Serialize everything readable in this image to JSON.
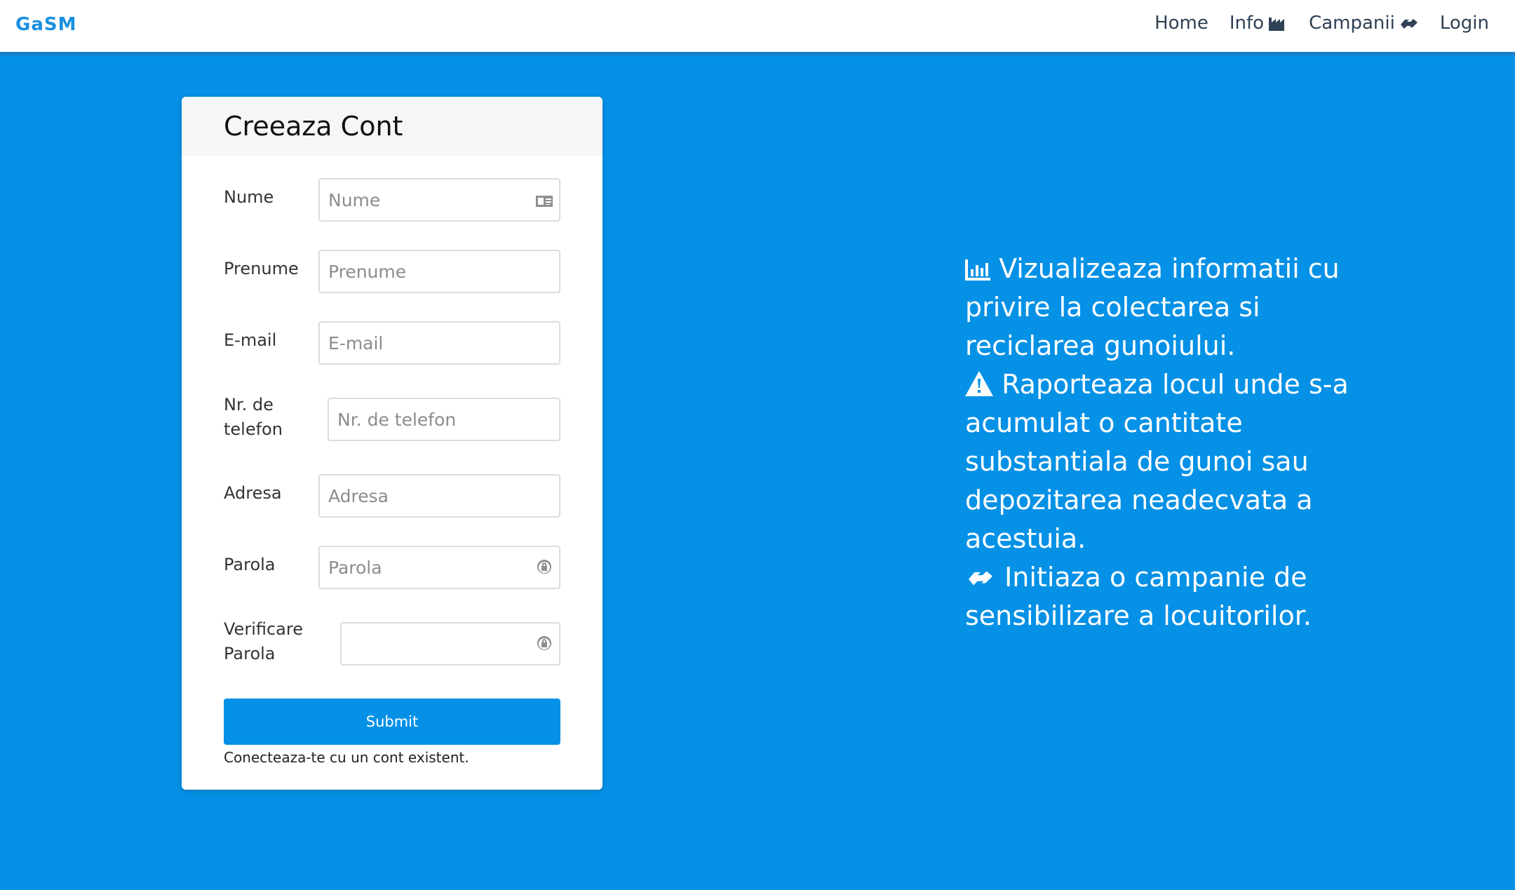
{
  "nav": {
    "brand": "GaSM",
    "links": [
      {
        "label": "Home",
        "icon": null
      },
      {
        "label": "Info",
        "icon": "industry-icon"
      },
      {
        "label": "Campanii",
        "icon": "handshake-icon"
      },
      {
        "label": "Login",
        "icon": null
      }
    ]
  },
  "form": {
    "title": "Creeaza Cont",
    "fields": [
      {
        "label": "Nume",
        "placeholder": "Nume",
        "icon": "id-card-icon"
      },
      {
        "label": "Prenume",
        "placeholder": "Prenume",
        "icon": null
      },
      {
        "label": "E-mail",
        "placeholder": "E-mail",
        "icon": null
      },
      {
        "label": "Nr. de telefon",
        "placeholder": "Nr. de telefon",
        "icon": null
      },
      {
        "label": "Adresa",
        "placeholder": "Adresa",
        "icon": null
      },
      {
        "label": "Parola",
        "placeholder": "Parola",
        "icon": "lock-icon"
      },
      {
        "label": "Verificare Parola",
        "placeholder": "",
        "icon": "lock-icon"
      }
    ],
    "submit_label": "Submit",
    "login_text": "Conecteaza-te cu un cont existent."
  },
  "info": {
    "lines": [
      {
        "icon": "chart-bar-icon",
        "text": "Vizualizeaza informatii cu privire la colectarea si reciclarea gunoiului."
      },
      {
        "icon": "warning-icon",
        "text": "Raporteaza locul unde s-a acumulat o cantitate substantiala de gunoi sau depozitarea neadecvata a acestuia."
      },
      {
        "icon": "handshake-icon",
        "text": "Initiaza o campanie de sensibilizare a locuitorilor."
      }
    ]
  },
  "colors": {
    "background": "#0591e6",
    "brand": "#1a8fe0",
    "button": "#0591e6"
  }
}
